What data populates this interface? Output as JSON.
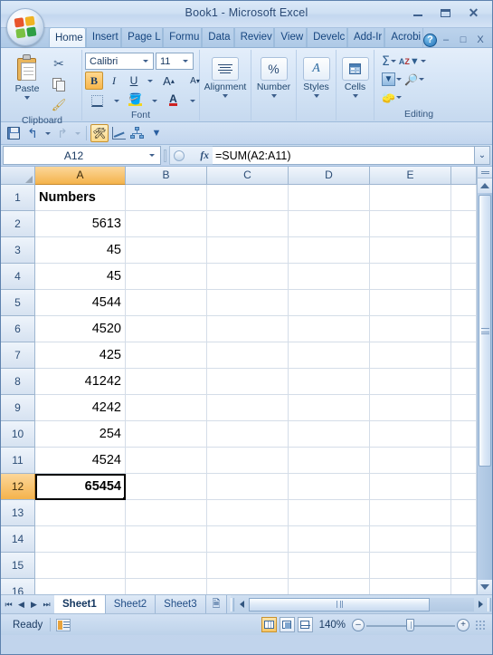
{
  "window": {
    "title": "Book1 - Microsoft Excel",
    "minimize": "–",
    "maximize": "□",
    "close": "X",
    "office_button": "office-orb"
  },
  "ribbon": {
    "tabs": [
      {
        "label": "Home",
        "active": true
      },
      {
        "label": "Insert",
        "active": false
      },
      {
        "label": "Page L",
        "active": false
      },
      {
        "label": "Formu",
        "active": false
      },
      {
        "label": "Data",
        "active": false
      },
      {
        "label": "Reviev",
        "active": false
      },
      {
        "label": "View",
        "active": false
      },
      {
        "label": "Develc",
        "active": false
      },
      {
        "label": "Add-Ir",
        "active": false
      },
      {
        "label": "Acrobi",
        "active": false
      }
    ],
    "help_label": "?",
    "ribbon_minimize": "–",
    "ribbon_restore": "□",
    "ribbon_close": "X",
    "groups": {
      "clipboard": {
        "label": "Clipboard",
        "paste_label": "Paste",
        "cut_label": "Cut",
        "copy_label": "Copy",
        "format_painter_label": "Format Painter"
      },
      "font": {
        "label": "Font",
        "font_name": "Calibri",
        "font_size": "11",
        "bold": "B",
        "italic": "I",
        "underline": "U",
        "grow_font": "A",
        "shrink_font": "A",
        "borders_label": "Borders",
        "fill_color_label": "Fill Color",
        "font_color_label": "Font Color"
      },
      "alignment": {
        "label": "Alignment"
      },
      "number": {
        "label": "Number",
        "symbol": "%"
      },
      "styles": {
        "label": "Styles",
        "symbol": "A"
      },
      "cells": {
        "label": "Cells"
      },
      "editing": {
        "label": "Editing",
        "autosum": "Σ",
        "sort_filter_label": "Sort & Filter",
        "fill_label": "Fill",
        "find_select_label": "Find & Select",
        "clear_label": "Clear"
      }
    }
  },
  "quick_access": {
    "save": "Save",
    "undo": "Undo",
    "redo": "Redo",
    "custom_tool": "Custom Tool",
    "chart": "Chart",
    "diagram": "Diagram",
    "more": "Customize Quick Access Toolbar"
  },
  "formula_bar": {
    "name_box": "A12",
    "fx_label": "fx",
    "formula": "=SUM(A2:A11)",
    "expand": "Expand Formula Bar"
  },
  "grid": {
    "columns": [
      {
        "label": "A",
        "width": 100,
        "selected": true
      },
      {
        "label": "B",
        "width": 90,
        "selected": false
      },
      {
        "label": "C",
        "width": 90,
        "selected": false
      },
      {
        "label": "D",
        "width": 90,
        "selected": false
      },
      {
        "label": "E",
        "width": 90,
        "selected": false
      },
      {
        "label": "",
        "width": 30,
        "selected": false
      }
    ],
    "active_cell": "A12",
    "rows": [
      {
        "header": "1",
        "selected": false,
        "cells": [
          {
            "value": "Numbers",
            "bold": true,
            "align": "left"
          },
          {
            "value": ""
          },
          {
            "value": ""
          },
          {
            "value": ""
          },
          {
            "value": ""
          },
          {
            "value": ""
          }
        ]
      },
      {
        "header": "2",
        "selected": false,
        "cells": [
          {
            "value": "5613"
          },
          {
            "value": ""
          },
          {
            "value": ""
          },
          {
            "value": ""
          },
          {
            "value": ""
          },
          {
            "value": ""
          }
        ]
      },
      {
        "header": "3",
        "selected": false,
        "cells": [
          {
            "value": "45"
          },
          {
            "value": ""
          },
          {
            "value": ""
          },
          {
            "value": ""
          },
          {
            "value": ""
          },
          {
            "value": ""
          }
        ]
      },
      {
        "header": "4",
        "selected": false,
        "cells": [
          {
            "value": "45"
          },
          {
            "value": ""
          },
          {
            "value": ""
          },
          {
            "value": ""
          },
          {
            "value": ""
          },
          {
            "value": ""
          }
        ]
      },
      {
        "header": "5",
        "selected": false,
        "cells": [
          {
            "value": "4544"
          },
          {
            "value": ""
          },
          {
            "value": ""
          },
          {
            "value": ""
          },
          {
            "value": ""
          },
          {
            "value": ""
          }
        ]
      },
      {
        "header": "6",
        "selected": false,
        "cells": [
          {
            "value": "4520"
          },
          {
            "value": ""
          },
          {
            "value": ""
          },
          {
            "value": ""
          },
          {
            "value": ""
          },
          {
            "value": ""
          }
        ]
      },
      {
        "header": "7",
        "selected": false,
        "cells": [
          {
            "value": "425"
          },
          {
            "value": ""
          },
          {
            "value": ""
          },
          {
            "value": ""
          },
          {
            "value": ""
          },
          {
            "value": ""
          }
        ]
      },
      {
        "header": "8",
        "selected": false,
        "cells": [
          {
            "value": "41242"
          },
          {
            "value": ""
          },
          {
            "value": ""
          },
          {
            "value": ""
          },
          {
            "value": ""
          },
          {
            "value": ""
          }
        ]
      },
      {
        "header": "9",
        "selected": false,
        "cells": [
          {
            "value": "4242"
          },
          {
            "value": ""
          },
          {
            "value": ""
          },
          {
            "value": ""
          },
          {
            "value": ""
          },
          {
            "value": ""
          }
        ]
      },
      {
        "header": "10",
        "selected": false,
        "cells": [
          {
            "value": "254"
          },
          {
            "value": ""
          },
          {
            "value": ""
          },
          {
            "value": ""
          },
          {
            "value": ""
          },
          {
            "value": ""
          }
        ]
      },
      {
        "header": "11",
        "selected": false,
        "cells": [
          {
            "value": "4524"
          },
          {
            "value": ""
          },
          {
            "value": ""
          },
          {
            "value": ""
          },
          {
            "value": ""
          },
          {
            "value": ""
          }
        ]
      },
      {
        "header": "12",
        "selected": true,
        "cells": [
          {
            "value": "65454",
            "bold": true,
            "active": true
          },
          {
            "value": ""
          },
          {
            "value": ""
          },
          {
            "value": ""
          },
          {
            "value": ""
          },
          {
            "value": ""
          }
        ]
      },
      {
        "header": "13",
        "selected": false,
        "cells": [
          {
            "value": ""
          },
          {
            "value": ""
          },
          {
            "value": ""
          },
          {
            "value": ""
          },
          {
            "value": ""
          },
          {
            "value": ""
          }
        ]
      },
      {
        "header": "14",
        "selected": false,
        "cells": [
          {
            "value": ""
          },
          {
            "value": ""
          },
          {
            "value": ""
          },
          {
            "value": ""
          },
          {
            "value": ""
          },
          {
            "value": ""
          }
        ]
      },
      {
        "header": "15",
        "selected": false,
        "cells": [
          {
            "value": ""
          },
          {
            "value": ""
          },
          {
            "value": ""
          },
          {
            "value": ""
          },
          {
            "value": ""
          },
          {
            "value": ""
          }
        ]
      },
      {
        "header": "16",
        "selected": false,
        "cells": [
          {
            "value": ""
          },
          {
            "value": ""
          },
          {
            "value": ""
          },
          {
            "value": ""
          },
          {
            "value": ""
          },
          {
            "value": ""
          }
        ]
      }
    ]
  },
  "sheet_tabs": {
    "first": "First Sheet",
    "prev": "Previous Sheet",
    "next": "Next Sheet",
    "last": "Last Sheet",
    "sheets": [
      {
        "label": "Sheet1",
        "active": true
      },
      {
        "label": "Sheet2",
        "active": false
      },
      {
        "label": "Sheet3",
        "active": false
      }
    ],
    "insert_sheet": "Insert Worksheet"
  },
  "status_bar": {
    "status": "Ready",
    "macro_record": "Record Macro",
    "view_normal": "Normal",
    "view_page_layout": "Page Layout",
    "view_page_break": "Page Break Preview",
    "zoom": "140%",
    "zoom_out": "–",
    "zoom_in": "+"
  },
  "colors": {
    "accent": "#f4b34c",
    "titlebar": "#cfe0f3",
    "ribbon": "#d7e6f7",
    "selection_border": "#000000",
    "grid_line": "#d4dde8"
  }
}
